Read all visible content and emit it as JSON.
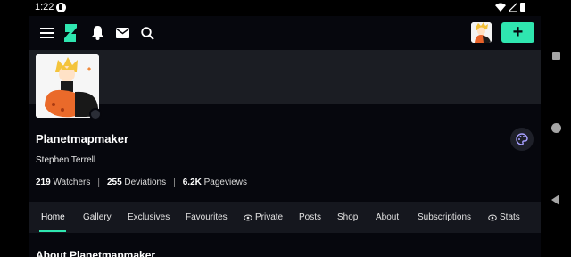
{
  "status_bar": {
    "time": "1:22"
  },
  "header": {
    "icons": [
      "menu-icon",
      "deviantart-logo-icon",
      "bell-icon",
      "mail-icon",
      "search-icon"
    ],
    "submit_label": "+",
    "accent": "#2fe6b0"
  },
  "profile": {
    "username": "Planetmapmaker",
    "real_name": "Stephen Terrell",
    "stats": [
      {
        "count": "219",
        "label": "Watchers"
      },
      {
        "count": "255",
        "label": "Deviations"
      },
      {
        "count": "6.2K",
        "label": "Pageviews"
      }
    ],
    "separator": "|"
  },
  "tabs": [
    {
      "label": "Home",
      "active": true
    },
    {
      "label": "Gallery"
    },
    {
      "label": "Exclusives"
    },
    {
      "label": "Favourites"
    },
    {
      "label": "Private",
      "icon": "eye-off-icon"
    },
    {
      "label": "Posts"
    },
    {
      "label": "Shop"
    },
    {
      "label": "About"
    },
    {
      "label": "Subscriptions"
    },
    {
      "label": "Stats",
      "icon": "eye-off-icon"
    }
  ],
  "section_peek": "About Planetmapmaker",
  "colors": {
    "background": "#06070d",
    "banner": "#1b1d23",
    "tabs_bg": "#15171e"
  }
}
